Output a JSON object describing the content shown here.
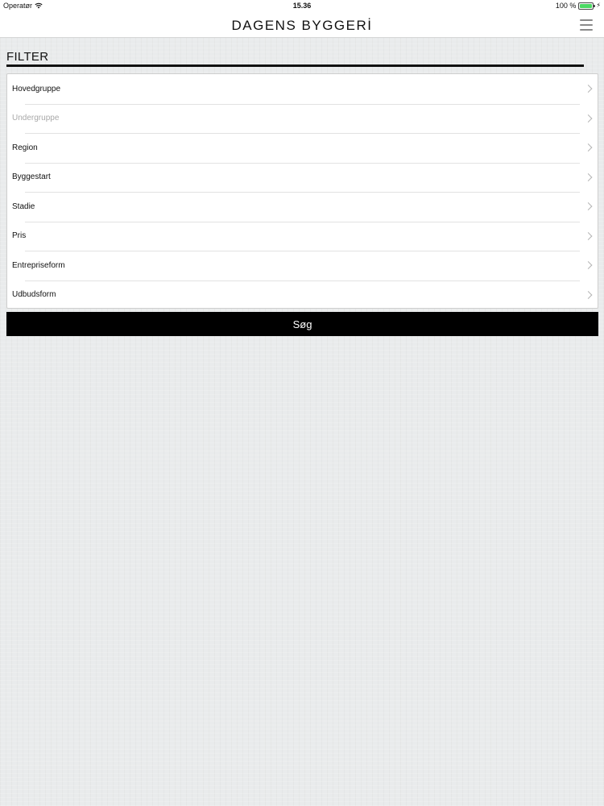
{
  "status_bar": {
    "carrier": "Operatør",
    "time": "15.36",
    "battery": "100 %",
    "battery_level": 1.0,
    "battery_color": "#4cd964"
  },
  "navbar": {
    "logo": "DAGENS BYGGERİ",
    "menu_icon": "hamburger-menu-icon"
  },
  "filter": {
    "title": "FILTER",
    "items": [
      {
        "label": "Hovedgruppe",
        "enabled": true
      },
      {
        "label": "Undergruppe",
        "enabled": false
      },
      {
        "label": "Region",
        "enabled": true
      },
      {
        "label": "Byggestart",
        "enabled": true
      },
      {
        "label": "Stadie",
        "enabled": true
      },
      {
        "label": "Pris",
        "enabled": true
      },
      {
        "label": "Entrepriseform",
        "enabled": true
      },
      {
        "label": "Udbudsform",
        "enabled": true
      }
    ],
    "chevron_icon": "chevron-right-icon"
  },
  "search_button": {
    "label": "Søg"
  }
}
